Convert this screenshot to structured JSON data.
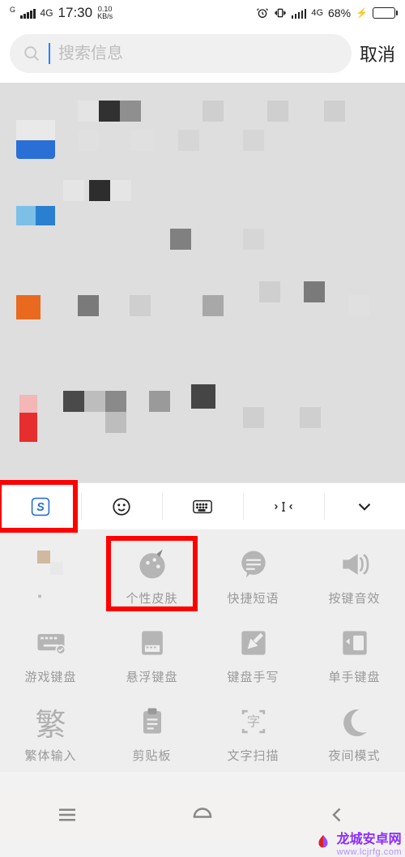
{
  "status": {
    "net": "G",
    "signal_label": "4G",
    "time": "17:30",
    "kbs_top": "0.10",
    "kbs_bot": "KB/s",
    "alarm": "⏰",
    "vibrate": "📳",
    "net2": "4G",
    "battery_pct": "68%",
    "charge": "⚡"
  },
  "search": {
    "placeholder": "搜索信息",
    "cancel": "取消"
  },
  "toolbar": {
    "logo_label": "S",
    "emoji": "emoji",
    "keyboard": "keyboard",
    "cursor": "cursor",
    "collapse": "collapse"
  },
  "panel": {
    "items": [
      {
        "label": "",
        "blurred": true
      },
      {
        "label": "个性皮肤",
        "highlighted": true
      },
      {
        "label": "快捷短语"
      },
      {
        "label": "按键音效"
      },
      {
        "label": "游戏键盘"
      },
      {
        "label": "悬浮键盘"
      },
      {
        "label": "键盘手写"
      },
      {
        "label": "单手键盘"
      },
      {
        "label": "繁体输入"
      },
      {
        "label": "剪贴板"
      },
      {
        "label": "文字扫描"
      },
      {
        "label": "夜间模式"
      }
    ]
  },
  "watermark": {
    "name": "龙城安卓网",
    "url": "www.lcjrfg.com"
  }
}
